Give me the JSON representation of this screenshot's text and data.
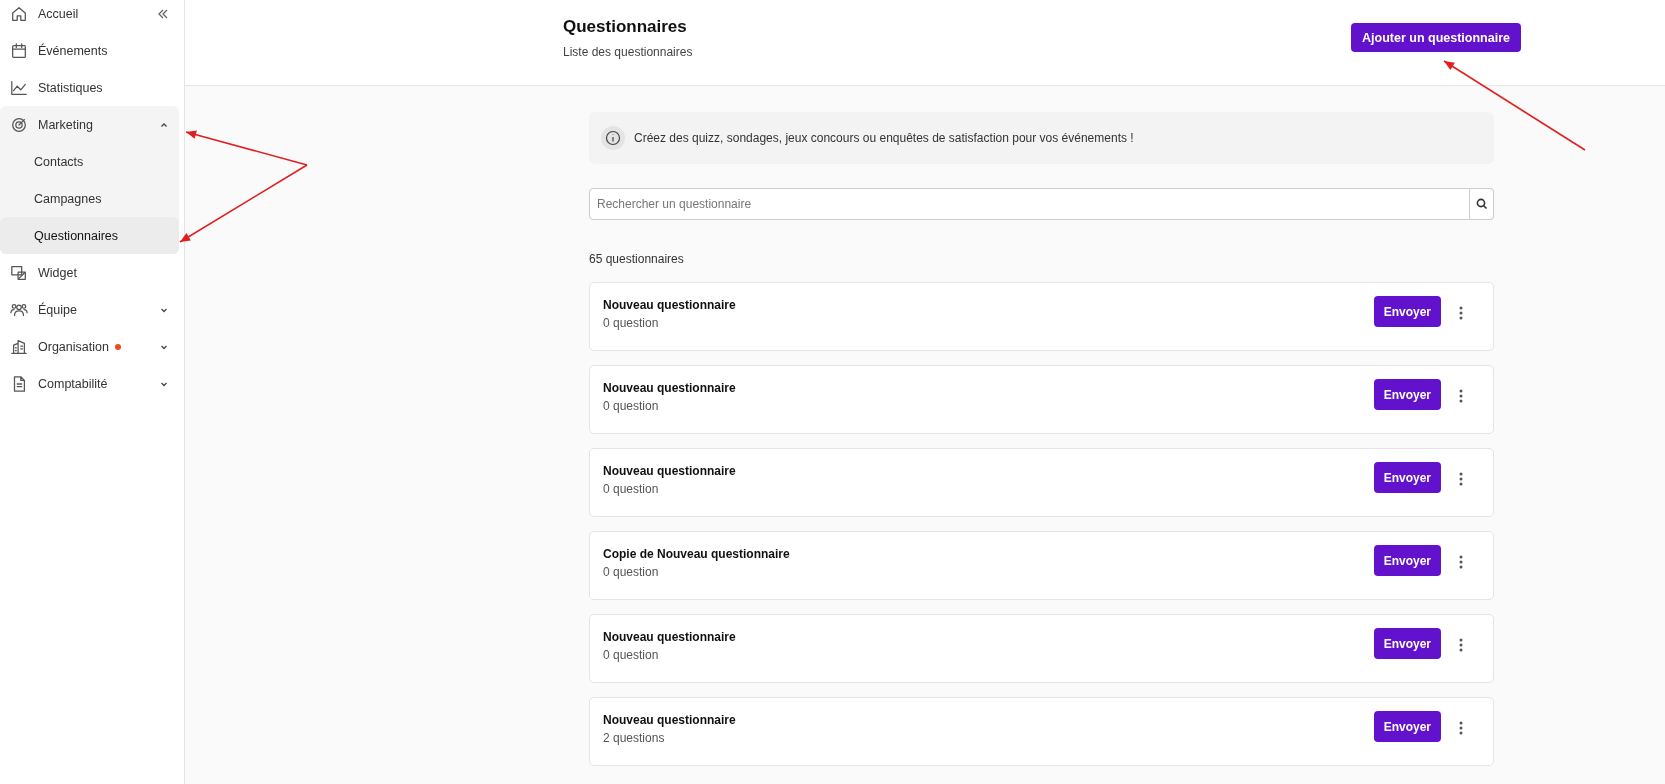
{
  "sidebar": {
    "items": [
      {
        "label": "Accueil",
        "selected": false
      },
      {
        "label": "Événements",
        "selected": false
      },
      {
        "label": "Statistiques",
        "selected": false
      },
      {
        "label": "Marketing",
        "selected": false,
        "expanded": true,
        "children": [
          {
            "label": "Contacts",
            "selected": false
          },
          {
            "label": "Campagnes",
            "selected": false
          },
          {
            "label": "Questionnaires",
            "selected": true
          }
        ]
      },
      {
        "label": "Widget",
        "selected": false
      },
      {
        "label": "Équipe",
        "selected": false,
        "expanded": false
      },
      {
        "label": "Organisation",
        "selected": false,
        "expanded": false,
        "notification": true
      },
      {
        "label": "Comptabilité",
        "selected": false,
        "expanded": false
      }
    ]
  },
  "header": {
    "title": "Questionnaires",
    "subtitle": "Liste des questionnaires",
    "add_button": "Ajouter un questionnaire"
  },
  "info_banner": "Créez des quizz, sondages, jeux concours ou enquêtes de satisfaction pour vos événements !",
  "search": {
    "placeholder": "Rechercher un questionnaire"
  },
  "count": "65 questionnaires",
  "questionnaires": [
    {
      "title": "Nouveau questionnaire",
      "questions": "0 question",
      "button": "Envoyer"
    },
    {
      "title": "Nouveau questionnaire",
      "questions": "0 question",
      "button": "Envoyer"
    },
    {
      "title": "Nouveau questionnaire",
      "questions": "0 question",
      "button": "Envoyer"
    },
    {
      "title": "Copie de Nouveau questionnaire",
      "questions": "0 question",
      "button": "Envoyer"
    },
    {
      "title": "Nouveau questionnaire",
      "questions": "0 question",
      "button": "Envoyer"
    },
    {
      "title": "Nouveau questionnaire",
      "questions": "2 questions",
      "button": "Envoyer"
    }
  ]
}
